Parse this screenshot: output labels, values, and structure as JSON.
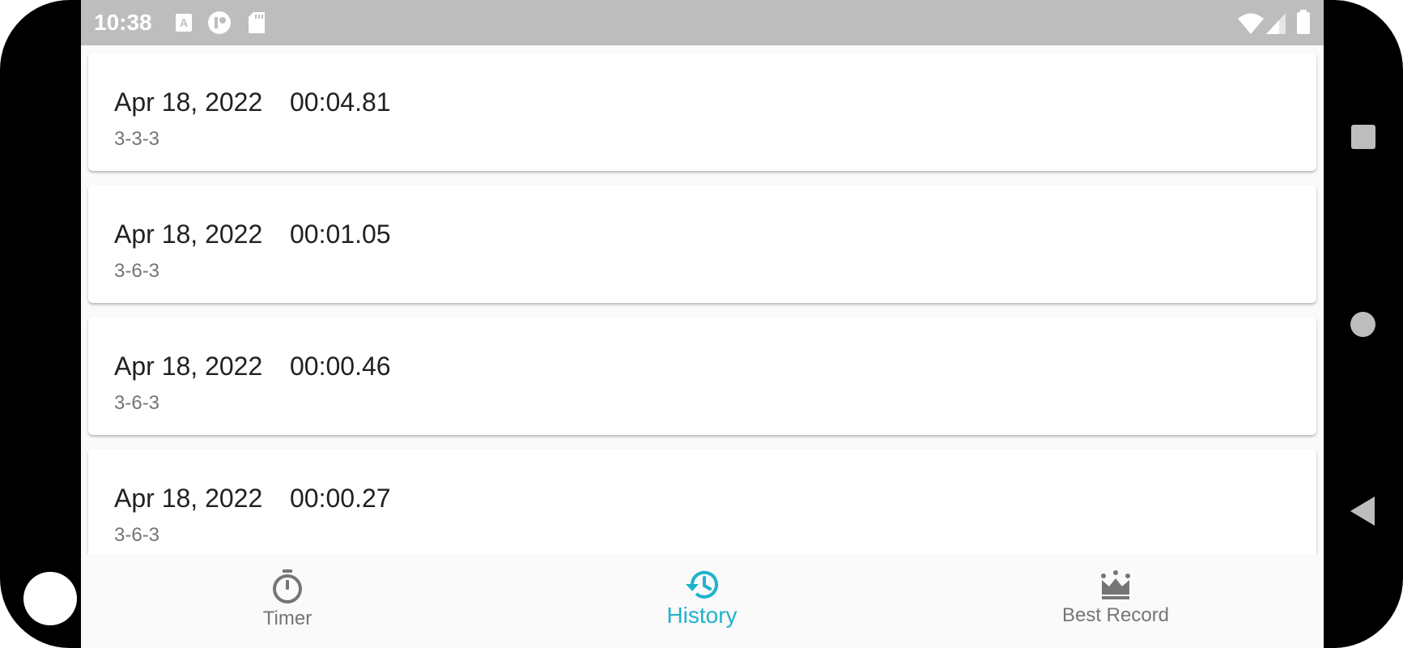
{
  "status_bar": {
    "time": "10:38",
    "left_icons": [
      "font-a-icon",
      "app-notification-icon",
      "sd-card-icon"
    ],
    "right_icons": [
      "wifi-icon",
      "signal-icon",
      "battery-icon"
    ]
  },
  "history": {
    "items": [
      {
        "date": "Apr 18, 2022",
        "time": "00:04.81",
        "config": "3-3-3"
      },
      {
        "date": "Apr 18, 2022",
        "time": "00:01.05",
        "config": "3-6-3"
      },
      {
        "date": "Apr 18, 2022",
        "time": "00:00.46",
        "config": "3-6-3"
      },
      {
        "date": "Apr 18, 2022",
        "time": "00:00.27",
        "config": "3-6-3"
      }
    ]
  },
  "bottom_nav": {
    "items": [
      {
        "label": "Timer",
        "icon": "stopwatch-icon",
        "active": false
      },
      {
        "label": "History",
        "icon": "history-icon",
        "active": true
      },
      {
        "label": "Best Record",
        "icon": "crown-icon",
        "active": false
      }
    ]
  },
  "colors": {
    "accent": "#1fb2ce",
    "inactive": "#757575",
    "status_bar": "#bdbdbd"
  }
}
